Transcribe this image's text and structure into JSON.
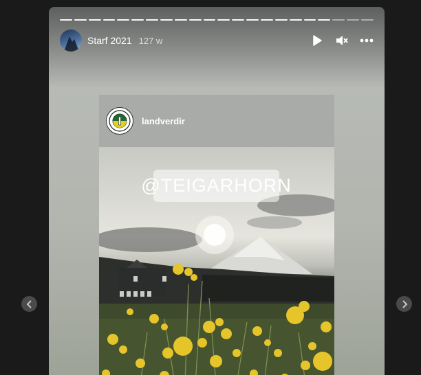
{
  "story": {
    "progress": {
      "total_segments": 22,
      "completed_segments": 19
    },
    "username": "Starf 2021",
    "time": "127 w",
    "controls": [
      "play-icon",
      "mute-icon",
      "more-icon"
    ]
  },
  "post": {
    "username": "landverdir",
    "overlay_tag": "@TEIGARHORN"
  },
  "colors": {
    "background": "#1a1a1a",
    "story_gradient_top": "#5d5f5e",
    "story_gradient_mid": "#b7bab5"
  },
  "navigation": {
    "prev_icon": "chevron-left-icon",
    "next_icon": "chevron-right-icon"
  }
}
